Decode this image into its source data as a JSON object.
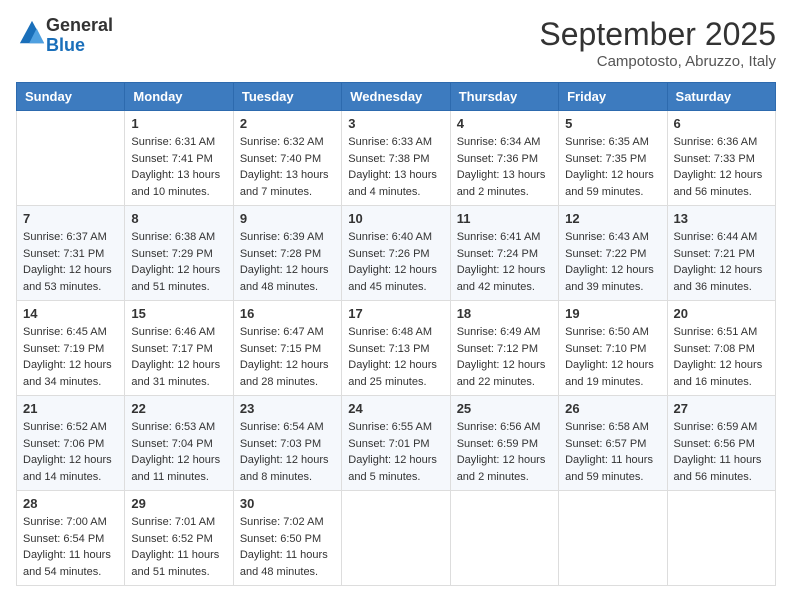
{
  "header": {
    "logo_general": "General",
    "logo_blue": "Blue",
    "month_title": "September 2025",
    "location": "Campotosto, Abruzzo, Italy"
  },
  "days_of_week": [
    "Sunday",
    "Monday",
    "Tuesday",
    "Wednesday",
    "Thursday",
    "Friday",
    "Saturday"
  ],
  "weeks": [
    [
      {
        "day": "",
        "sunrise": "",
        "sunset": "",
        "daylight": ""
      },
      {
        "day": "1",
        "sunrise": "Sunrise: 6:31 AM",
        "sunset": "Sunset: 7:41 PM",
        "daylight": "Daylight: 13 hours and 10 minutes."
      },
      {
        "day": "2",
        "sunrise": "Sunrise: 6:32 AM",
        "sunset": "Sunset: 7:40 PM",
        "daylight": "Daylight: 13 hours and 7 minutes."
      },
      {
        "day": "3",
        "sunrise": "Sunrise: 6:33 AM",
        "sunset": "Sunset: 7:38 PM",
        "daylight": "Daylight: 13 hours and 4 minutes."
      },
      {
        "day": "4",
        "sunrise": "Sunrise: 6:34 AM",
        "sunset": "Sunset: 7:36 PM",
        "daylight": "Daylight: 13 hours and 2 minutes."
      },
      {
        "day": "5",
        "sunrise": "Sunrise: 6:35 AM",
        "sunset": "Sunset: 7:35 PM",
        "daylight": "Daylight: 12 hours and 59 minutes."
      },
      {
        "day": "6",
        "sunrise": "Sunrise: 6:36 AM",
        "sunset": "Sunset: 7:33 PM",
        "daylight": "Daylight: 12 hours and 56 minutes."
      }
    ],
    [
      {
        "day": "7",
        "sunrise": "Sunrise: 6:37 AM",
        "sunset": "Sunset: 7:31 PM",
        "daylight": "Daylight: 12 hours and 53 minutes."
      },
      {
        "day": "8",
        "sunrise": "Sunrise: 6:38 AM",
        "sunset": "Sunset: 7:29 PM",
        "daylight": "Daylight: 12 hours and 51 minutes."
      },
      {
        "day": "9",
        "sunrise": "Sunrise: 6:39 AM",
        "sunset": "Sunset: 7:28 PM",
        "daylight": "Daylight: 12 hours and 48 minutes."
      },
      {
        "day": "10",
        "sunrise": "Sunrise: 6:40 AM",
        "sunset": "Sunset: 7:26 PM",
        "daylight": "Daylight: 12 hours and 45 minutes."
      },
      {
        "day": "11",
        "sunrise": "Sunrise: 6:41 AM",
        "sunset": "Sunset: 7:24 PM",
        "daylight": "Daylight: 12 hours and 42 minutes."
      },
      {
        "day": "12",
        "sunrise": "Sunrise: 6:43 AM",
        "sunset": "Sunset: 7:22 PM",
        "daylight": "Daylight: 12 hours and 39 minutes."
      },
      {
        "day": "13",
        "sunrise": "Sunrise: 6:44 AM",
        "sunset": "Sunset: 7:21 PM",
        "daylight": "Daylight: 12 hours and 36 minutes."
      }
    ],
    [
      {
        "day": "14",
        "sunrise": "Sunrise: 6:45 AM",
        "sunset": "Sunset: 7:19 PM",
        "daylight": "Daylight: 12 hours and 34 minutes."
      },
      {
        "day": "15",
        "sunrise": "Sunrise: 6:46 AM",
        "sunset": "Sunset: 7:17 PM",
        "daylight": "Daylight: 12 hours and 31 minutes."
      },
      {
        "day": "16",
        "sunrise": "Sunrise: 6:47 AM",
        "sunset": "Sunset: 7:15 PM",
        "daylight": "Daylight: 12 hours and 28 minutes."
      },
      {
        "day": "17",
        "sunrise": "Sunrise: 6:48 AM",
        "sunset": "Sunset: 7:13 PM",
        "daylight": "Daylight: 12 hours and 25 minutes."
      },
      {
        "day": "18",
        "sunrise": "Sunrise: 6:49 AM",
        "sunset": "Sunset: 7:12 PM",
        "daylight": "Daylight: 12 hours and 22 minutes."
      },
      {
        "day": "19",
        "sunrise": "Sunrise: 6:50 AM",
        "sunset": "Sunset: 7:10 PM",
        "daylight": "Daylight: 12 hours and 19 minutes."
      },
      {
        "day": "20",
        "sunrise": "Sunrise: 6:51 AM",
        "sunset": "Sunset: 7:08 PM",
        "daylight": "Daylight: 12 hours and 16 minutes."
      }
    ],
    [
      {
        "day": "21",
        "sunrise": "Sunrise: 6:52 AM",
        "sunset": "Sunset: 7:06 PM",
        "daylight": "Daylight: 12 hours and 14 minutes."
      },
      {
        "day": "22",
        "sunrise": "Sunrise: 6:53 AM",
        "sunset": "Sunset: 7:04 PM",
        "daylight": "Daylight: 12 hours and 11 minutes."
      },
      {
        "day": "23",
        "sunrise": "Sunrise: 6:54 AM",
        "sunset": "Sunset: 7:03 PM",
        "daylight": "Daylight: 12 hours and 8 minutes."
      },
      {
        "day": "24",
        "sunrise": "Sunrise: 6:55 AM",
        "sunset": "Sunset: 7:01 PM",
        "daylight": "Daylight: 12 hours and 5 minutes."
      },
      {
        "day": "25",
        "sunrise": "Sunrise: 6:56 AM",
        "sunset": "Sunset: 6:59 PM",
        "daylight": "Daylight: 12 hours and 2 minutes."
      },
      {
        "day": "26",
        "sunrise": "Sunrise: 6:58 AM",
        "sunset": "Sunset: 6:57 PM",
        "daylight": "Daylight: 11 hours and 59 minutes."
      },
      {
        "day": "27",
        "sunrise": "Sunrise: 6:59 AM",
        "sunset": "Sunset: 6:56 PM",
        "daylight": "Daylight: 11 hours and 56 minutes."
      }
    ],
    [
      {
        "day": "28",
        "sunrise": "Sunrise: 7:00 AM",
        "sunset": "Sunset: 6:54 PM",
        "daylight": "Daylight: 11 hours and 54 minutes."
      },
      {
        "day": "29",
        "sunrise": "Sunrise: 7:01 AM",
        "sunset": "Sunset: 6:52 PM",
        "daylight": "Daylight: 11 hours and 51 minutes."
      },
      {
        "day": "30",
        "sunrise": "Sunrise: 7:02 AM",
        "sunset": "Sunset: 6:50 PM",
        "daylight": "Daylight: 11 hours and 48 minutes."
      },
      {
        "day": "",
        "sunrise": "",
        "sunset": "",
        "daylight": ""
      },
      {
        "day": "",
        "sunrise": "",
        "sunset": "",
        "daylight": ""
      },
      {
        "day": "",
        "sunrise": "",
        "sunset": "",
        "daylight": ""
      },
      {
        "day": "",
        "sunrise": "",
        "sunset": "",
        "daylight": ""
      }
    ]
  ]
}
